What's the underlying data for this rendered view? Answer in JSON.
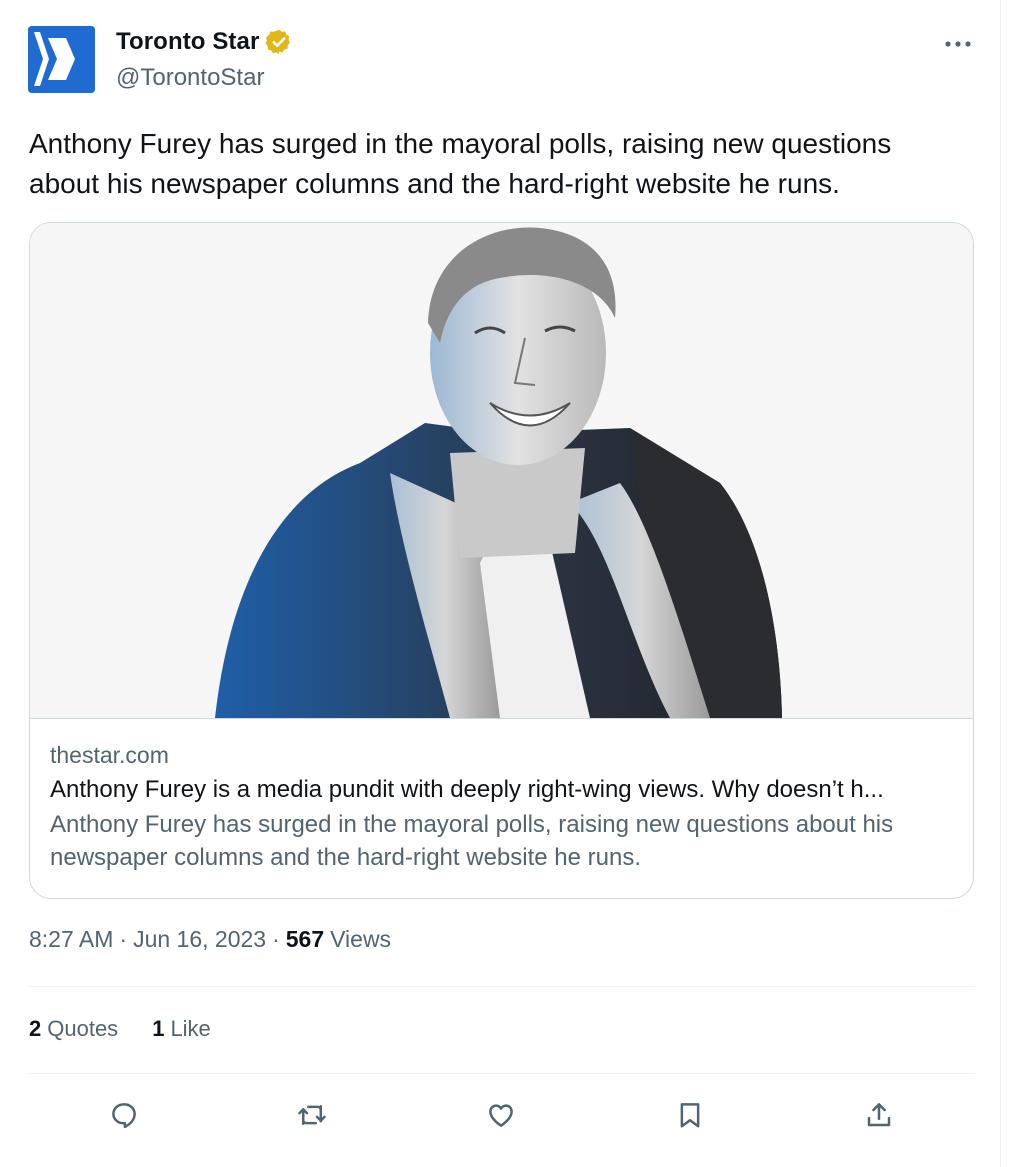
{
  "colors": {
    "text_primary": "#0f1419",
    "text_secondary": "#536471",
    "border": "#cfd9de",
    "verified_gold": "#e2b719",
    "brand_blue": "#1f6bd1"
  },
  "author": {
    "display_name": "Toronto Star",
    "handle": "@TorontoStar",
    "avatar_icon": "toronto-star-logo-icon",
    "verified_icon": "verified-badge-icon"
  },
  "more_icon": "more-icon",
  "tweet": {
    "text": "Anthony Furey has surged in the mayoral polls, raising new questions about his newspaper columns and the hard-right website he runs."
  },
  "card": {
    "image_icon": "article-portrait-illustration",
    "domain": "thestar.com",
    "title": "Anthony Furey is a media pundit with deeply right-wing views. Why doesn’t h...",
    "description": "Anthony Furey has surged in the mayoral polls, raising new questions about his newspaper columns and the hard-right website he runs."
  },
  "meta": {
    "time": "8:27 AM",
    "separator": "·",
    "date": "Jun 16, 2023",
    "views_count": "567",
    "views_label": "Views"
  },
  "stats": {
    "quotes_count": "2",
    "quotes_label": "Quotes",
    "likes_count": "1",
    "likes_label": "Like"
  },
  "actions": [
    "reply-icon",
    "retweet-icon",
    "like-icon",
    "bookmark-icon",
    "share-icon"
  ]
}
